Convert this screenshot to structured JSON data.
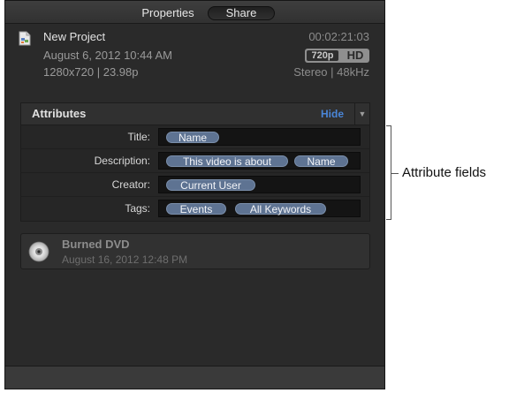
{
  "tabs": {
    "properties_label": "Properties",
    "share_label": "Share"
  },
  "project": {
    "name": "New Project",
    "date": "August 6, 2012 10:44 AM",
    "spec": "1280x720  |  23.98p",
    "duration": "00:02:21:03",
    "resolution_badge": "720p",
    "hd_badge": "HD",
    "audio_spec": "Stereo  |  48kHz"
  },
  "attributes": {
    "title": "Attributes",
    "hide_label": "Hide",
    "rows": [
      {
        "label": "Title:",
        "tokens": [
          "Name"
        ]
      },
      {
        "label": "Description:",
        "tokens": [
          "This video is about",
          "Name"
        ]
      },
      {
        "label": "Creator:",
        "tokens": [
          "Current User"
        ]
      },
      {
        "label": "Tags:",
        "tokens": [
          "Events",
          "All Keywords"
        ]
      }
    ]
  },
  "callout": {
    "text": "Attribute fields"
  },
  "history_item": {
    "title": "Burned DVD",
    "date": "August 16, 2012 12:48 PM",
    "icon": "dvd-disc-icon"
  },
  "colors": {
    "panel_bg": "#2a2a2a",
    "token_bg": "#5e7392",
    "hide_link": "#4a86d8"
  }
}
